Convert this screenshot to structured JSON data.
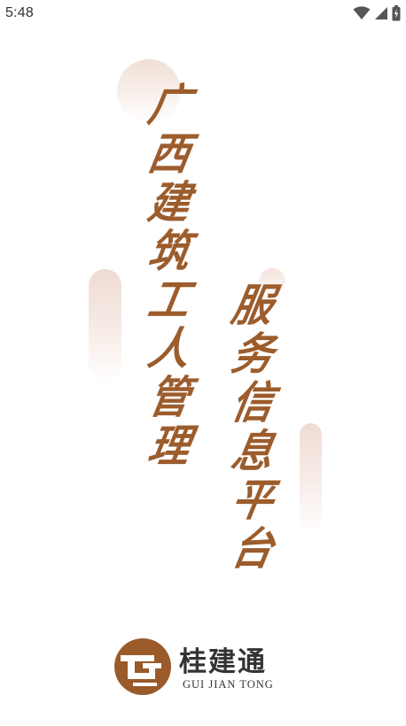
{
  "status_bar": {
    "time": "5:48",
    "icons": [
      "wifi-icon",
      "cellular-signal-icon",
      "battery-charging-icon"
    ]
  },
  "slogan": {
    "column1": [
      "广",
      "西",
      "建",
      "筑",
      "工",
      "人",
      "管",
      "理"
    ],
    "column2": [
      "服",
      "务",
      "信",
      "息",
      "平",
      "台"
    ],
    "color": "#9c5c2c"
  },
  "logo": {
    "name_cn": "桂建通",
    "name_en": "GUI JIAN TONG",
    "mark_color": "#9a5a2a"
  }
}
